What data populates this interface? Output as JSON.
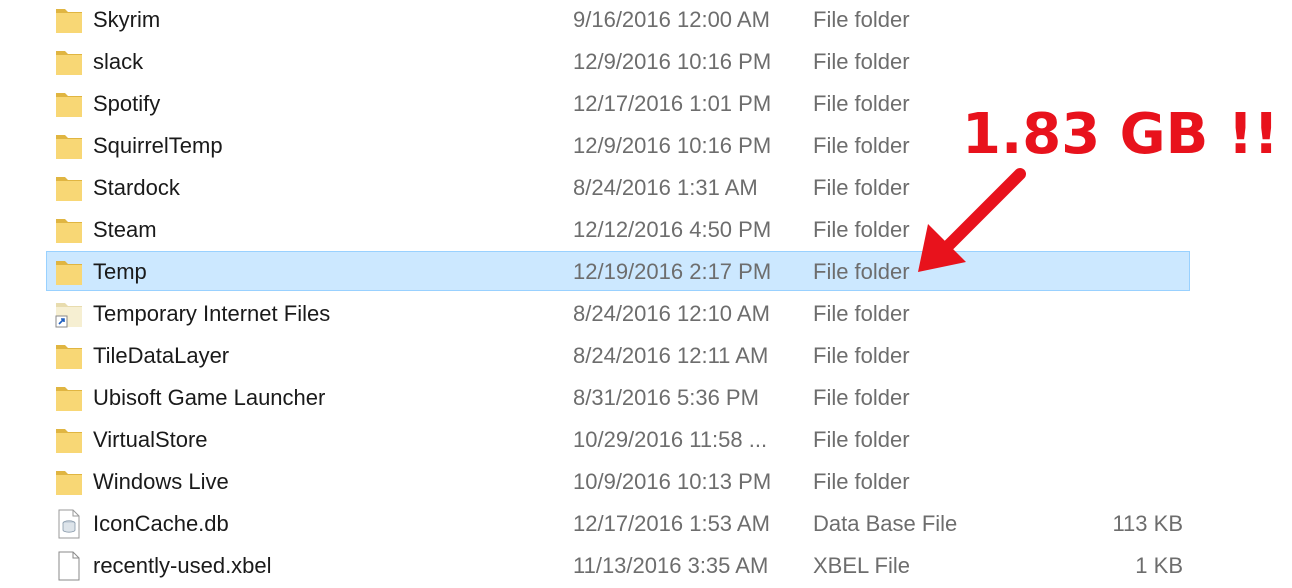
{
  "rows": [
    {
      "name": "Skyrim",
      "date": "9/16/2016 12:00 AM",
      "type": "File folder",
      "size": "",
      "icon": "folder-icon"
    },
    {
      "name": "slack",
      "date": "12/9/2016 10:16 PM",
      "type": "File folder",
      "size": "",
      "icon": "folder-icon"
    },
    {
      "name": "Spotify",
      "date": "12/17/2016 1:01 PM",
      "type": "File folder",
      "size": "",
      "icon": "folder-icon"
    },
    {
      "name": "SquirrelTemp",
      "date": "12/9/2016 10:16 PM",
      "type": "File folder",
      "size": "",
      "icon": "folder-icon"
    },
    {
      "name": "Stardock",
      "date": "8/24/2016 1:31 AM",
      "type": "File folder",
      "size": "",
      "icon": "folder-icon"
    },
    {
      "name": "Steam",
      "date": "12/12/2016 4:50 PM",
      "type": "File folder",
      "size": "",
      "icon": "folder-icon"
    },
    {
      "name": "Temp",
      "date": "12/19/2016 2:17 PM",
      "type": "File folder",
      "size": "",
      "icon": "folder-icon",
      "selected": true
    },
    {
      "name": "Temporary Internet Files",
      "date": "8/24/2016 12:10 AM",
      "type": "File folder",
      "size": "",
      "icon": "folder-shortcut-icon"
    },
    {
      "name": "TileDataLayer",
      "date": "8/24/2016 12:11 AM",
      "type": "File folder",
      "size": "",
      "icon": "folder-icon"
    },
    {
      "name": "Ubisoft Game Launcher",
      "date": "8/31/2016 5:36 PM",
      "type": "File folder",
      "size": "",
      "icon": "folder-icon"
    },
    {
      "name": "VirtualStore",
      "date": "10/29/2016 11:58 ...",
      "type": "File folder",
      "size": "",
      "icon": "folder-icon"
    },
    {
      "name": "Windows Live",
      "date": "10/9/2016 10:13 PM",
      "type": "File folder",
      "size": "",
      "icon": "folder-icon"
    },
    {
      "name": "IconCache.db",
      "date": "12/17/2016 1:53 AM",
      "type": "Data Base File",
      "size": "113 KB",
      "icon": "database-file-icon"
    },
    {
      "name": "recently-used.xbel",
      "date": "11/13/2016 3:35 AM",
      "type": "XBEL File",
      "size": "1 KB",
      "icon": "blank-file-icon"
    }
  ],
  "annotation": {
    "text": "1.83 GB !!",
    "color": "#e8121c"
  },
  "colors": {
    "selection_bg": "#cce8ff",
    "selection_border": "#99d1ff",
    "folder_yellow": "#f8d775",
    "folder_shadow": "#e0b541"
  }
}
